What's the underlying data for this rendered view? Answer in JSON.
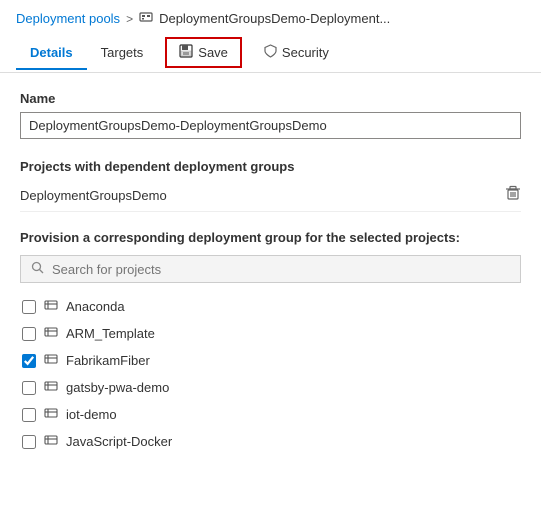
{
  "breadcrumb": {
    "link_label": "Deployment pools",
    "separator": ">",
    "icon": "⊞",
    "current": "DeploymentGroupsDemo-Deployment..."
  },
  "tabs": [
    {
      "id": "details",
      "label": "Details",
      "active": true
    },
    {
      "id": "targets",
      "label": "Targets",
      "active": false
    },
    {
      "id": "save",
      "label": "Save",
      "icon": "💾"
    },
    {
      "id": "security",
      "label": "Security",
      "icon": "🛡"
    }
  ],
  "name_field": {
    "label": "Name",
    "value": "DeploymentGroupsDemo-DeploymentGroupsDemo"
  },
  "dependent_projects": {
    "label": "Projects with dependent deployment groups",
    "projects": [
      {
        "name": "DeploymentGroupsDemo"
      }
    ]
  },
  "provision": {
    "label": "Provision a corresponding deployment group for the selected projects:",
    "search_placeholder": "Search for projects",
    "projects": [
      {
        "id": "anaconda",
        "label": "Anaconda",
        "checked": false
      },
      {
        "id": "arm-template",
        "label": "ARM_Template",
        "checked": false
      },
      {
        "id": "fabrikamfiber",
        "label": "FabrikamFiber",
        "checked": true
      },
      {
        "id": "gatsby-pwa-demo",
        "label": "gatsby-pwa-demo",
        "checked": false
      },
      {
        "id": "iot-demo",
        "label": "iot-demo",
        "checked": false
      },
      {
        "id": "javascript-docker",
        "label": "JavaScript-Docker",
        "checked": false
      }
    ]
  }
}
